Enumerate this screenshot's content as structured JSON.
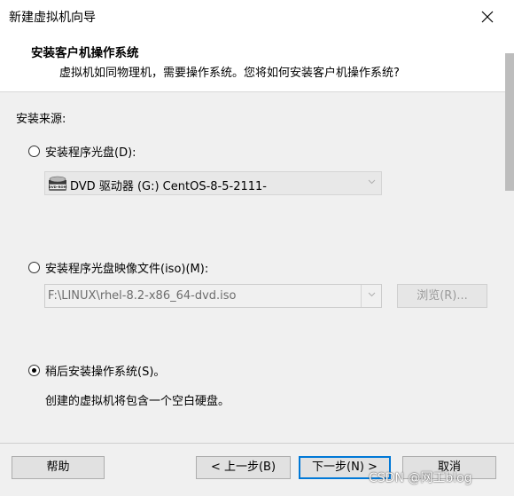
{
  "window": {
    "title": "新建虚拟机向导"
  },
  "header": {
    "title": "安装客户机操作系统",
    "subtitle": "虚拟机如同物理机，需要操作系统。您将如何安装客户机操作系统?"
  },
  "section": {
    "label": "安装来源:"
  },
  "options": {
    "disc": {
      "label": "安装程序光盘(D):",
      "selected": false,
      "drive_value": "DVD 驱动器 (G:) CentOS-8-5-2111-",
      "drive_icon_text": "DVD-ROM"
    },
    "iso": {
      "label": "安装程序光盘映像文件(iso)(M):",
      "selected": false,
      "path_value": "F:\\LINUX\\rhel-8.2-x86_64-dvd.iso",
      "browse_label": "浏览(R)..."
    },
    "later": {
      "label": "稍后安装操作系统(S)。",
      "selected": true,
      "description": "创建的虚拟机将包含一个空白硬盘。"
    }
  },
  "footer": {
    "help_label": "帮助",
    "back_label": "< 上一步(B)",
    "next_label": "下一步(N) >",
    "cancel_label": "取消"
  },
  "watermark": {
    "text": "CSDN @网工blog"
  }
}
